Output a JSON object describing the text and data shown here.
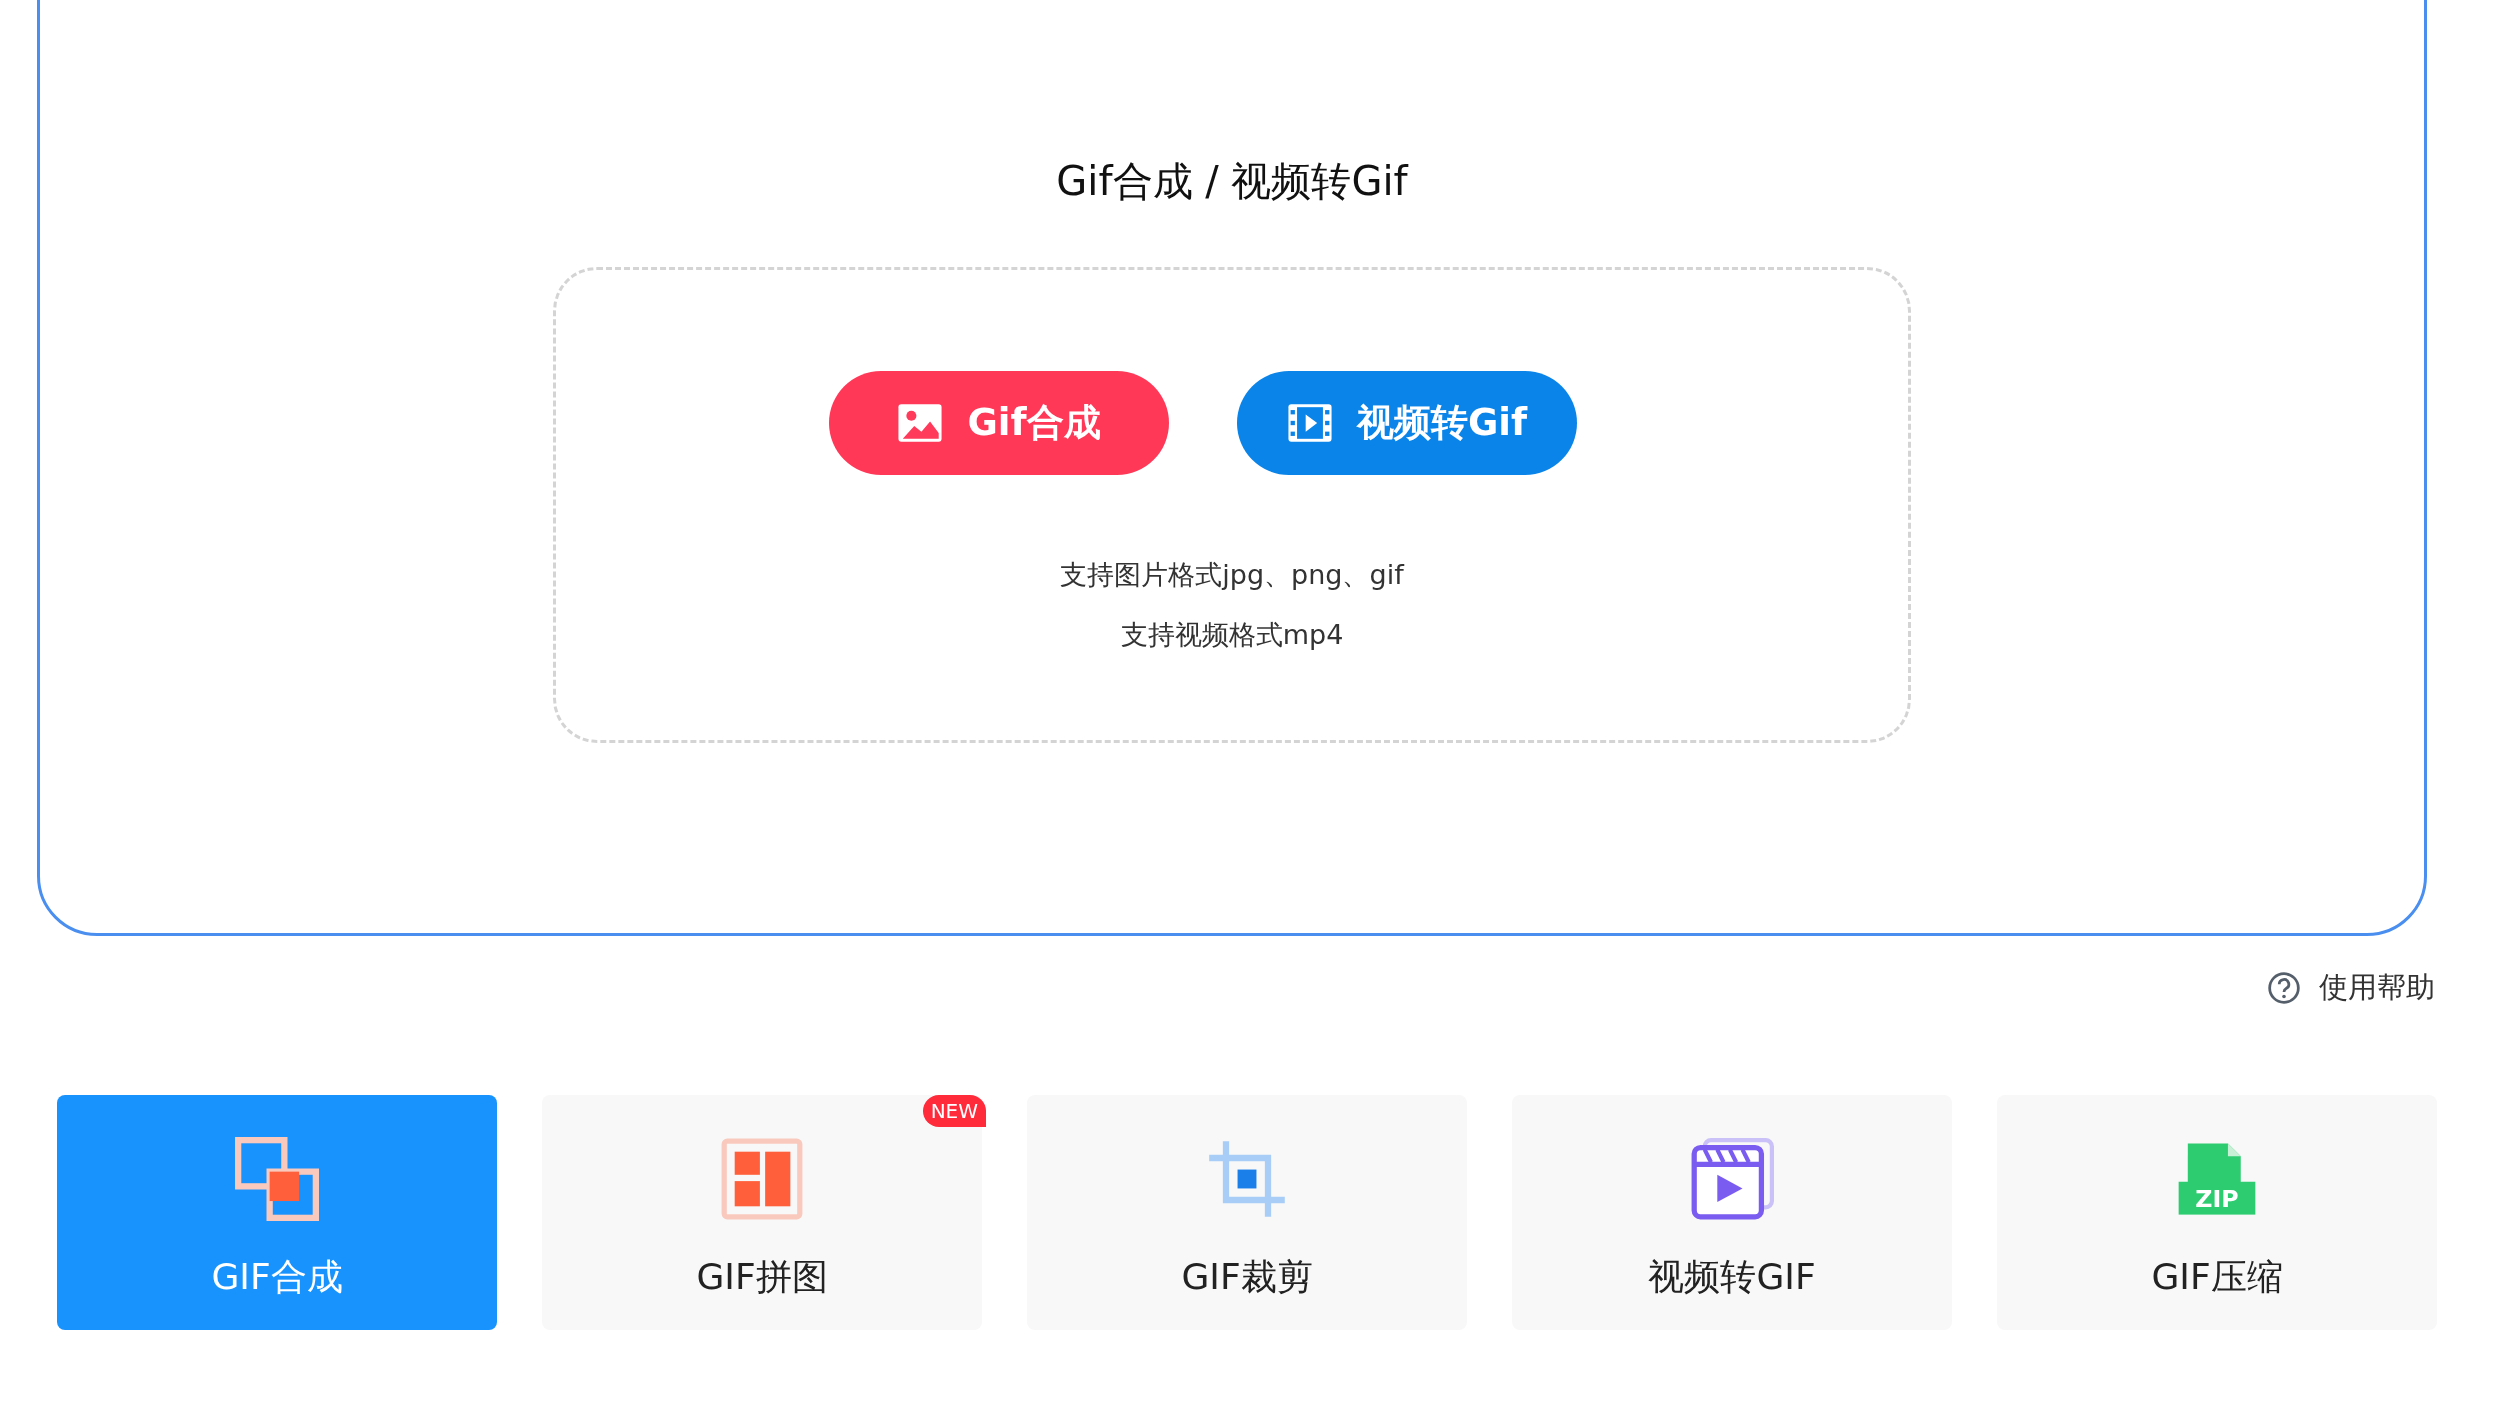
{
  "upload_panel": {
    "title": "Gif合成 / 视频转Gif",
    "buttons": [
      {
        "kind": "image",
        "label": "Gif合成"
      },
      {
        "kind": "video",
        "label": "视频转Gif"
      }
    ],
    "format_notes": [
      "支持图片格式jpg、png、gif",
      "支持视频格式mp4"
    ]
  },
  "help_link": {
    "label": "使用帮助"
  },
  "tools": [
    {
      "kind": "merge",
      "label": "GIF合成",
      "selected": true
    },
    {
      "kind": "collage",
      "label": "GIF拼图",
      "selected": false,
      "badge": "NEW"
    },
    {
      "kind": "crop",
      "label": "GIF裁剪",
      "selected": false
    },
    {
      "kind": "video",
      "label": "视频转GIF",
      "selected": false
    },
    {
      "kind": "zip",
      "label": "GIF压缩",
      "selected": false,
      "icon_label": "ZIP"
    }
  ]
}
